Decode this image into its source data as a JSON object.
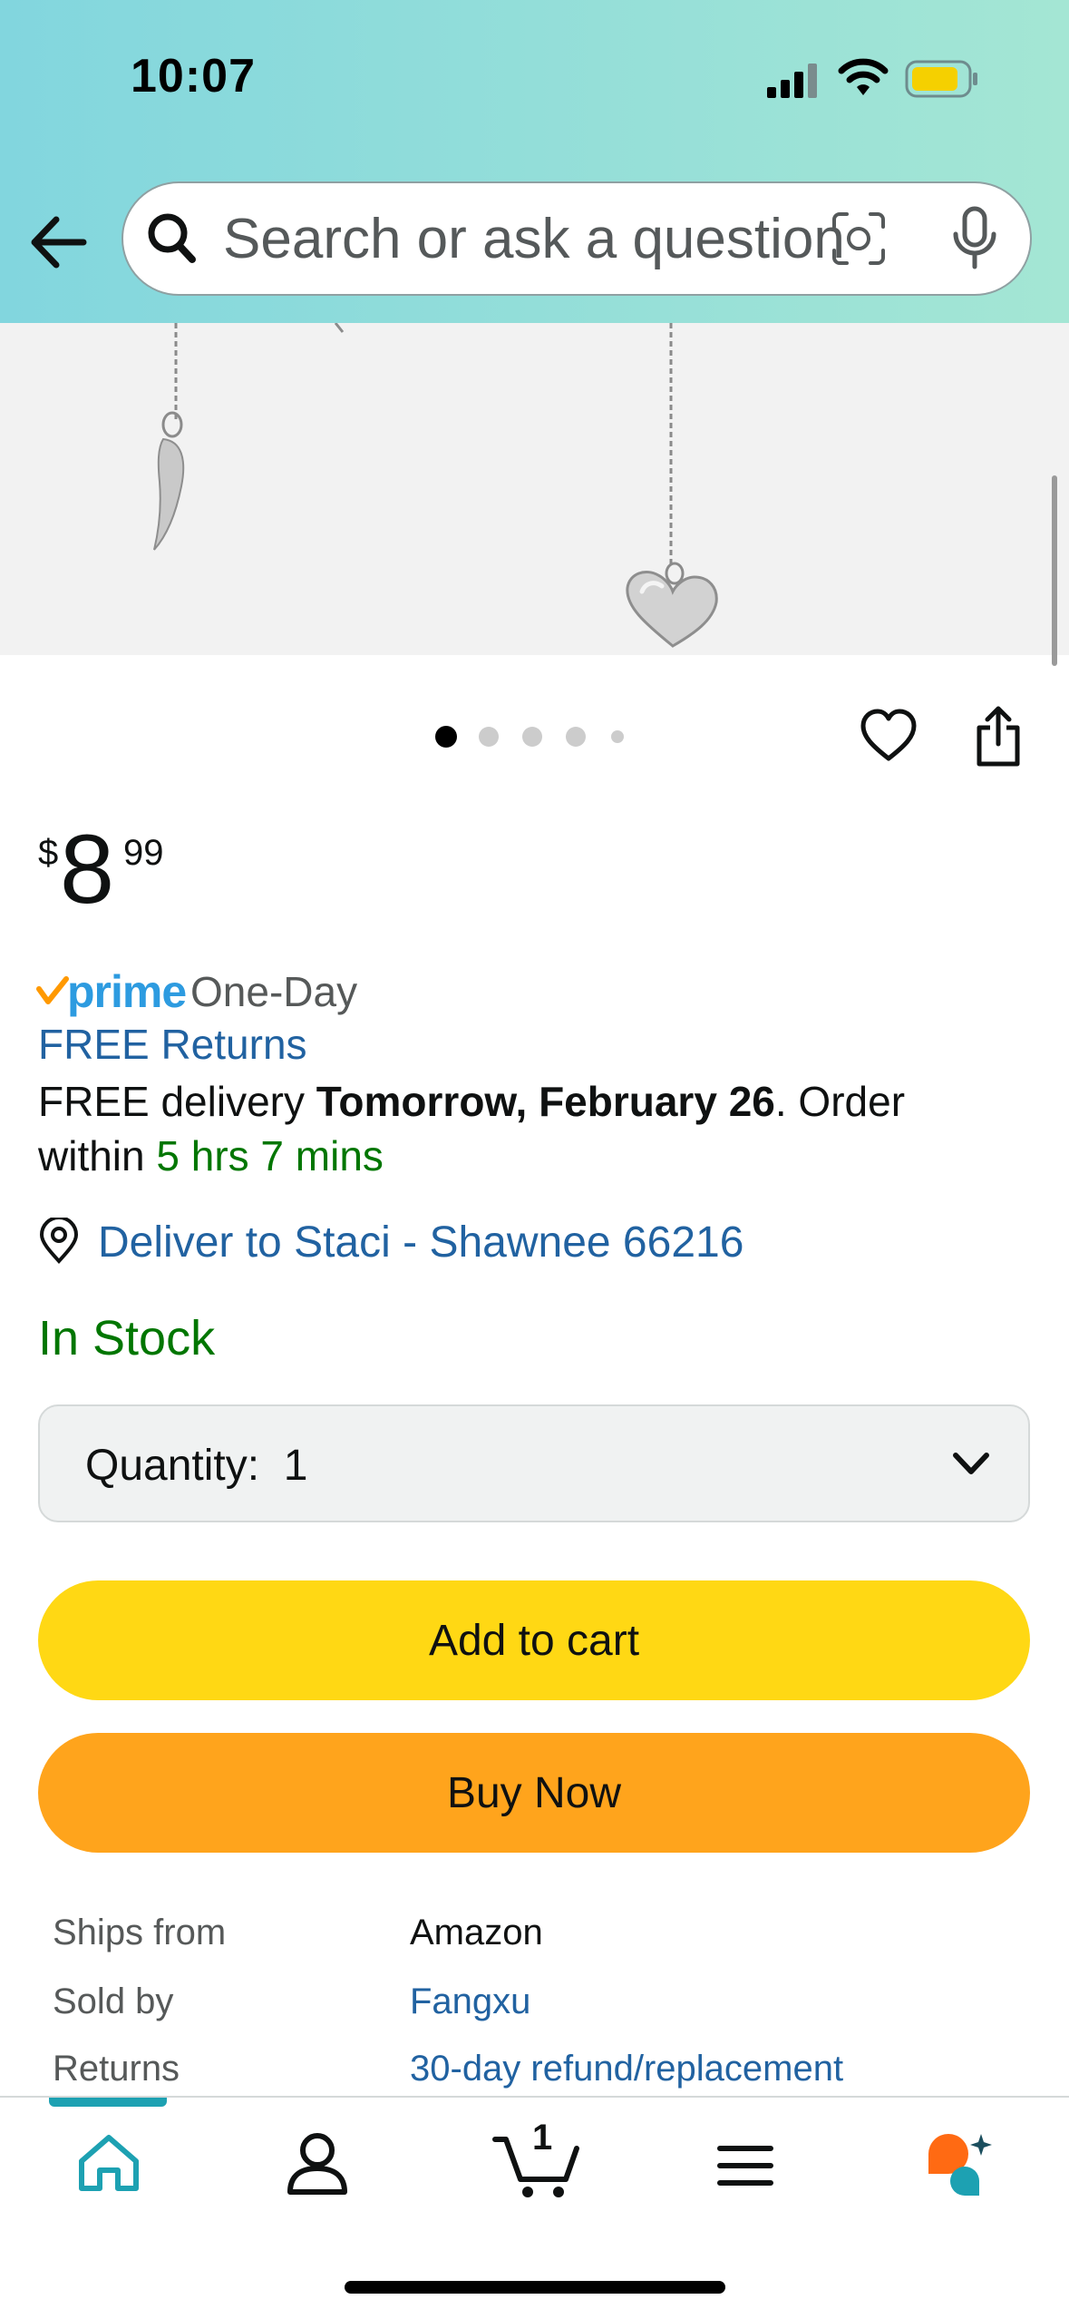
{
  "status": {
    "time": "10:07",
    "battery_color": "#F5D000"
  },
  "search": {
    "placeholder": "Search or ask a question"
  },
  "gallery": {
    "active_index": 0,
    "count": 5
  },
  "price": {
    "symbol": "$",
    "whole": "8",
    "fraction": "99"
  },
  "prime": {
    "word": "prime",
    "speed": "One-Day"
  },
  "returns": {
    "label": "FREE Returns"
  },
  "delivery": {
    "prefix": "FREE delivery ",
    "date": "Tomorrow, February 26",
    "mid": ". Order within ",
    "countdown": "5 hrs 7 mins"
  },
  "location": {
    "label": "Deliver to Staci - Shawnee 66216"
  },
  "stock": {
    "label": "In Stock"
  },
  "quantity": {
    "label": "Quantity:",
    "value": "1"
  },
  "buttons": {
    "add_to_cart": "Add to cart",
    "buy_now": "Buy Now"
  },
  "info": {
    "ships_from_label": "Ships from",
    "ships_from_value": "Amazon",
    "sold_by_label": "Sold by",
    "sold_by_value": "Fangxu",
    "returns_label": "Returns",
    "returns_value": "30-day refund/replacement"
  },
  "nav": {
    "cart_count": "1",
    "items": [
      "home-icon",
      "account-icon",
      "cart-icon",
      "menu-icon",
      "rufus-icon"
    ]
  },
  "colors": {
    "add_to_cart": "#FFD814",
    "buy_now": "#FFA41C",
    "link": "#2162A1",
    "in_stock": "#007600",
    "prime": "#2D9BE0",
    "nav_active": "#1DA1B2"
  }
}
